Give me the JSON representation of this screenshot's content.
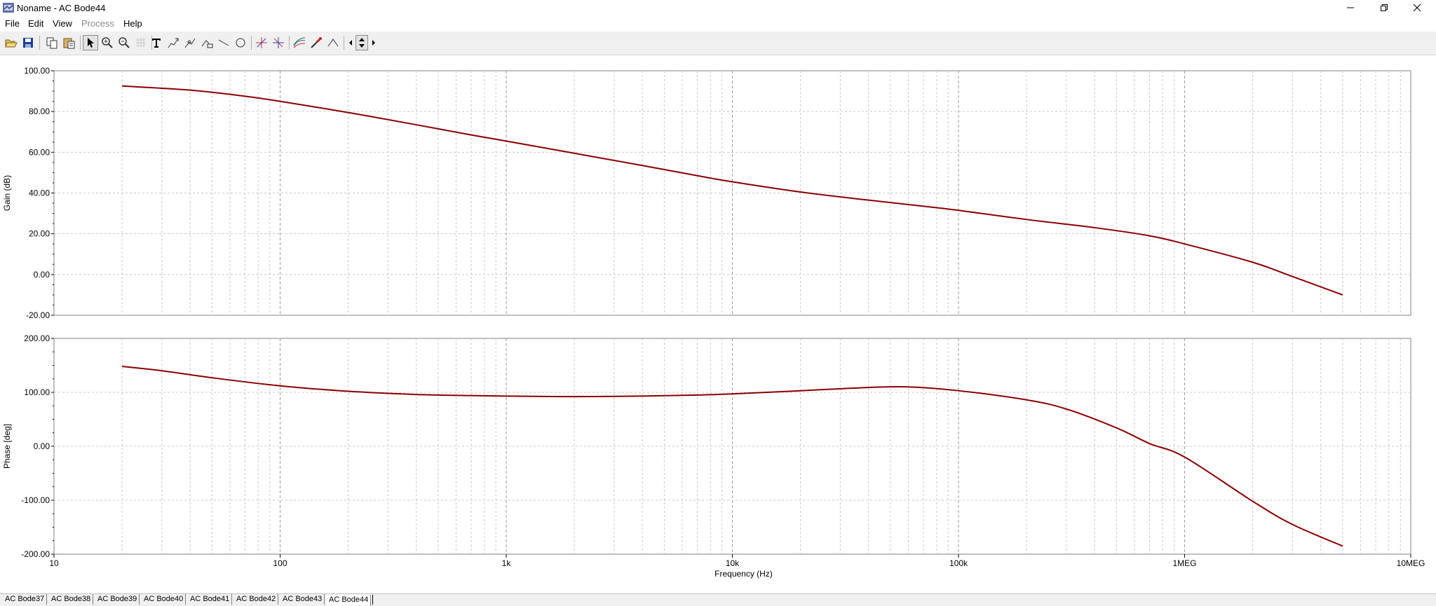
{
  "window": {
    "title": "Noname - AC Bode44",
    "controls": [
      "minimize",
      "restore",
      "close"
    ]
  },
  "menu": [
    {
      "label": "File",
      "enabled": true
    },
    {
      "label": "Edit",
      "enabled": true
    },
    {
      "label": "View",
      "enabled": true
    },
    {
      "label": "Process",
      "enabled": false
    },
    {
      "label": "Help",
      "enabled": true
    }
  ],
  "toolbar": {
    "tools": [
      {
        "name": "open-icon"
      },
      {
        "name": "save-icon"
      },
      {
        "name": "copy-icon"
      },
      {
        "name": "paste-icon"
      },
      {
        "name": "pointer-icon",
        "pressed": true
      },
      {
        "name": "zoom-in-icon"
      },
      {
        "name": "zoom-out-icon"
      },
      {
        "name": "grid-icon"
      },
      {
        "name": "text-icon"
      },
      {
        "name": "annotate-icon"
      },
      {
        "name": "marker-icon"
      },
      {
        "name": "label-icon"
      },
      {
        "name": "line-icon"
      },
      {
        "name": "circle-icon"
      },
      {
        "name": "cursor-a-icon"
      },
      {
        "name": "cursor-b-icon"
      },
      {
        "name": "curves-icon"
      },
      {
        "name": "probe-icon"
      },
      {
        "name": "step-icon"
      },
      {
        "name": "arrow-left-icon"
      },
      {
        "name": "arrow-updown-icon"
      },
      {
        "name": "arrow-right-icon"
      }
    ]
  },
  "colors": {
    "trace": "#8b0000",
    "grid": "#c8c8c8",
    "frame": "#808080"
  },
  "chart_data": [
    {
      "type": "line",
      "ylabel": "Gain (dB)",
      "xscale": "log",
      "xlim": [
        10,
        10000000
      ],
      "ylim": [
        -20,
        100
      ],
      "yticks": [
        "100.00",
        "80.00",
        "60.00",
        "40.00",
        "20.00",
        "0.00",
        "-20.00"
      ],
      "grid": true,
      "series": [
        {
          "x": [
            20,
            40,
            70,
            100,
            200,
            400,
            700,
            1000,
            2000,
            4000,
            7000,
            10000,
            20000,
            40000,
            70000,
            100000,
            200000,
            400000,
            700000,
            1000000,
            2000000,
            3000000,
            5000000
          ],
          "values": [
            92.5,
            90.5,
            87.5,
            85,
            79.5,
            73.5,
            68.5,
            65.5,
            59.5,
            53.5,
            48.5,
            45.5,
            40.5,
            36.5,
            33.5,
            31.5,
            27,
            23,
            19,
            15,
            6,
            -1,
            -10
          ]
        }
      ]
    },
    {
      "type": "line",
      "ylabel": "Phase [deg]",
      "xlabel": "Frequency (Hz)",
      "xscale": "log",
      "xlim": [
        10,
        10000000
      ],
      "ylim": [
        -200,
        200
      ],
      "yticks": [
        "200.00",
        "100.00",
        "0.00",
        "-100.00",
        "-200.00"
      ],
      "xticks": [
        "10",
        "100",
        "1k",
        "10k",
        "100k",
        "1MEG",
        "10MEG"
      ],
      "grid": true,
      "series": [
        {
          "x": [
            20,
            30,
            50,
            100,
            200,
            400,
            700,
            1000,
            2000,
            4000,
            7000,
            10000,
            20000,
            40000,
            60000,
            100000,
            200000,
            300000,
            500000,
            700000,
            1000000,
            2000000,
            3000000,
            5000000
          ],
          "values": [
            148,
            140,
            127,
            112,
            102,
            96,
            94,
            93,
            92,
            93,
            95,
            97,
            103,
            109,
            110,
            103,
            86,
            69,
            34,
            5,
            -20,
            -102,
            -145,
            -185
          ]
        }
      ]
    }
  ],
  "tabs": [
    {
      "label": "AC Bode37"
    },
    {
      "label": "AC Bode38"
    },
    {
      "label": "AC Bode39"
    },
    {
      "label": "AC Bode40"
    },
    {
      "label": "AC Bode41"
    },
    {
      "label": "AC Bode42"
    },
    {
      "label": "AC Bode43"
    },
    {
      "label": "AC Bode44",
      "active": true
    }
  ]
}
